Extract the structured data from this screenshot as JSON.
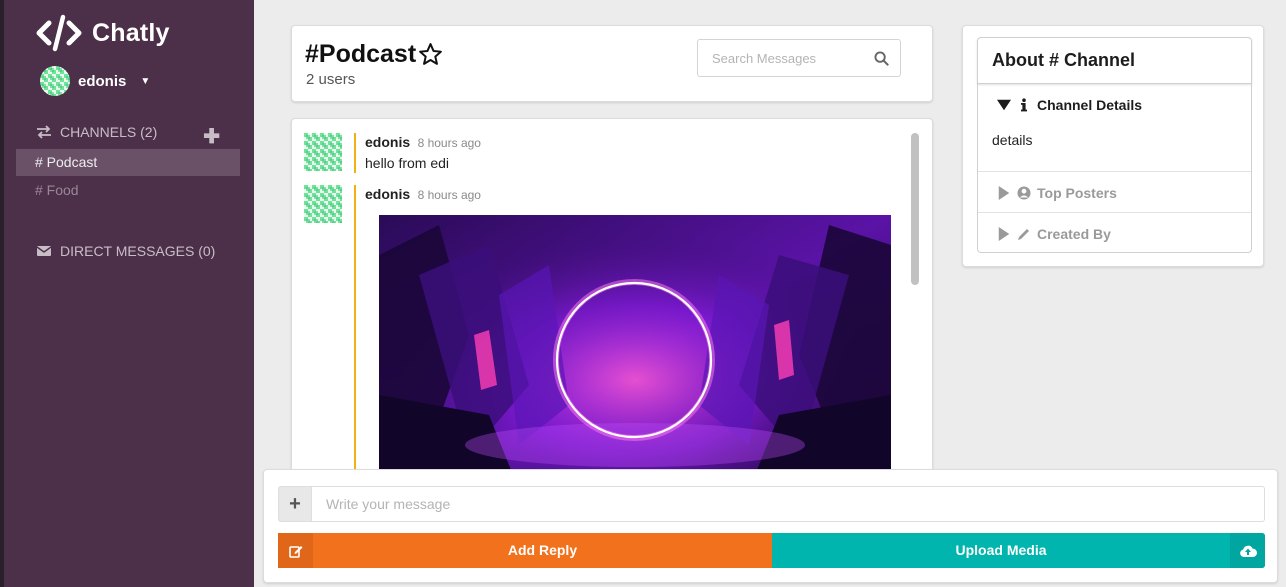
{
  "app": {
    "name": "Chatly"
  },
  "sidebar": {
    "user": {
      "name": "edonis"
    },
    "channels_label": "CHANNELS (2)",
    "channels": [
      {
        "label": "# Podcast",
        "active": true
      },
      {
        "label": "# Food",
        "active": false
      }
    ],
    "direct_messages_label": "DIRECT MESSAGES (0)"
  },
  "header": {
    "channel_title": "#Podcast",
    "users_count": "2 users",
    "search_placeholder": "Search Messages"
  },
  "messages": [
    {
      "author": "edonis",
      "time": "8 hours ago",
      "text": "hello from edi"
    },
    {
      "author": "edonis",
      "time": "8 hours ago",
      "text": "",
      "has_image": true
    }
  ],
  "about_panel": {
    "title": "About # Channel",
    "sections": [
      {
        "label": "Channel Details",
        "open": true,
        "icon": "info-icon",
        "body": "details"
      },
      {
        "label": "Top Posters",
        "open": false,
        "icon": "user-circle-icon"
      },
      {
        "label": "Created By",
        "open": false,
        "icon": "pencil-icon"
      }
    ]
  },
  "composer": {
    "placeholder": "Write your message",
    "reply_label": "Add Reply",
    "upload_label": "Upload Media"
  },
  "colors": {
    "sidebar_bg": "#4c3049",
    "rail_bg": "#2b1f2c",
    "accent_orange": "#f2711c",
    "accent_teal": "#00b5ad",
    "message_bar": "#f3b016"
  }
}
